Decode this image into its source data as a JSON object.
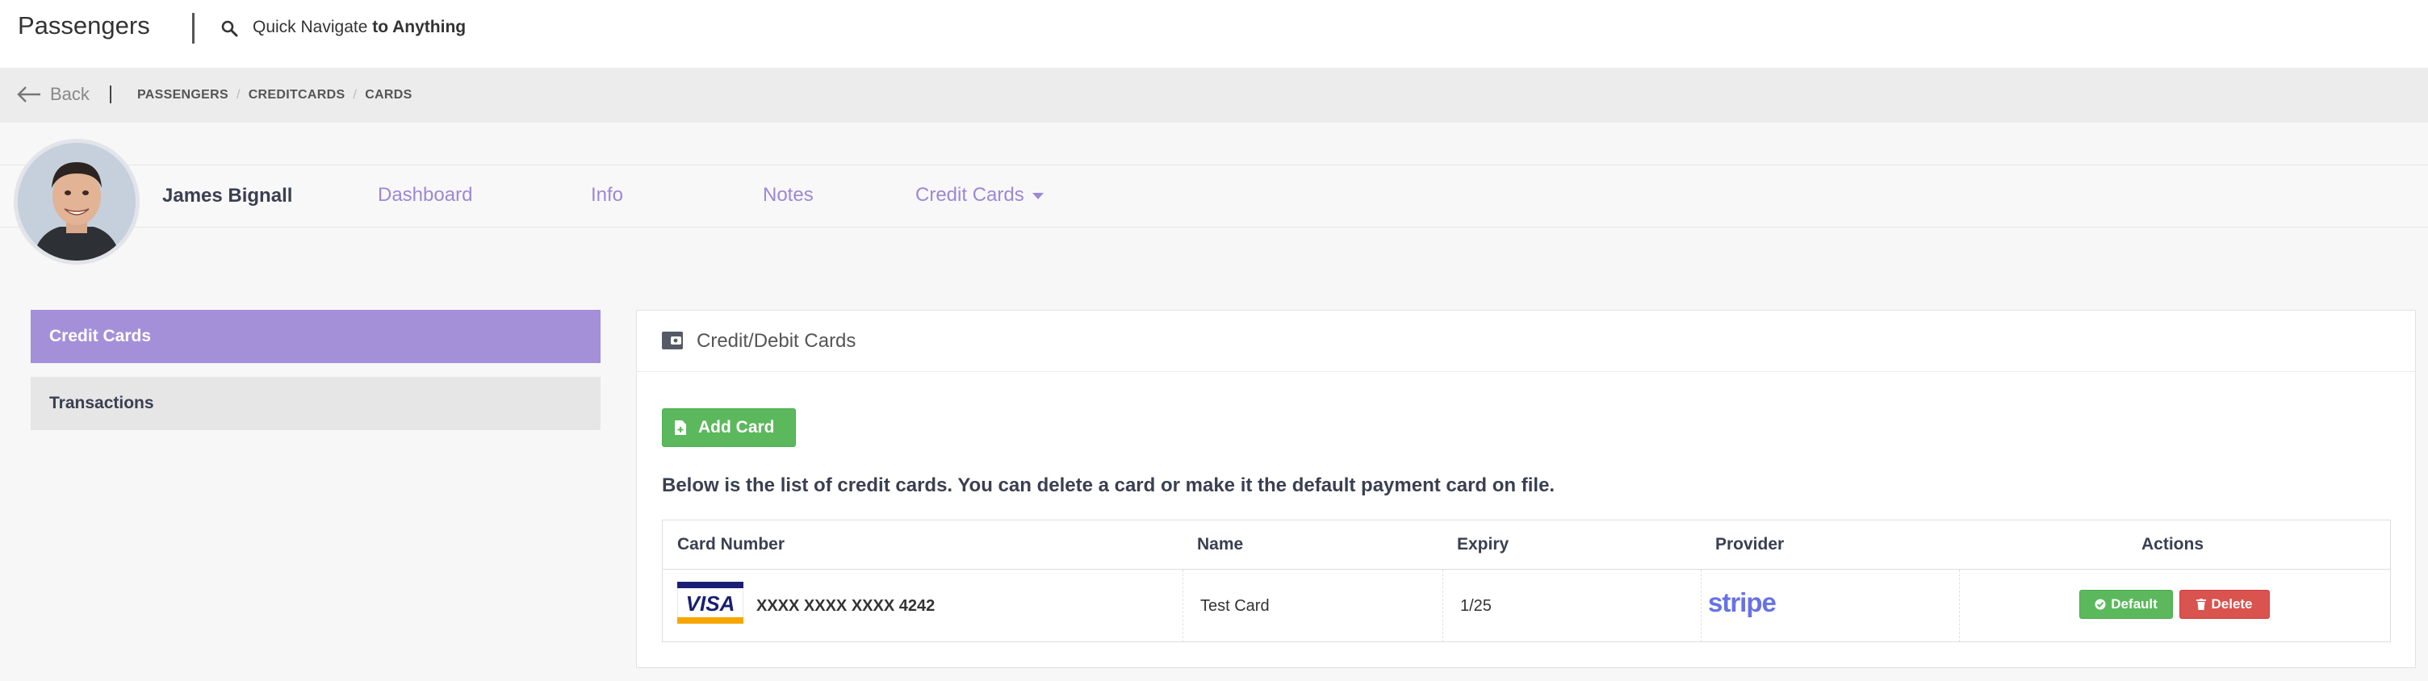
{
  "app": {
    "title": "Passengers"
  },
  "search": {
    "prefix": "Quick Navigate ",
    "suffix": "to Anything"
  },
  "breadcrumb": {
    "back_label": "Back",
    "items": [
      "PASSENGERS",
      "CREDITCARDS",
      "CARDS"
    ],
    "separator": "/"
  },
  "profile": {
    "name": "James Bignall",
    "tabs": [
      "Dashboard",
      "Info",
      "Notes",
      "Credit Cards"
    ]
  },
  "sidebar": {
    "items": [
      {
        "label": "Credit Cards",
        "active": true
      },
      {
        "label": "Transactions",
        "active": false
      }
    ]
  },
  "panel": {
    "title": "Credit/Debit Cards",
    "add_button": "Add Card",
    "info": "Below is the list of credit cards. You can delete a card or make it the default payment card on file."
  },
  "table": {
    "headers": [
      "Card Number",
      "Name",
      "Expiry",
      "Provider",
      "Actions"
    ],
    "rows": [
      {
        "brand_logo": "VISA",
        "card_number": "XXXX XXXX XXXX 4242",
        "name": "Test Card",
        "expiry": "1/25",
        "provider_logo": "stripe",
        "actions": [
          "Default",
          "Delete"
        ]
      }
    ]
  },
  "colors": {
    "accent": "#a48fd9",
    "tab_text": "#9c88d6",
    "success": "#5cb85c",
    "danger": "#d9534f",
    "stripe": "#6772e5"
  },
  "icons": [
    "search-icon",
    "back-arrow-icon",
    "caret-down-icon",
    "wallet-icon",
    "file-add-icon",
    "check-circle-icon",
    "trash-icon"
  ]
}
